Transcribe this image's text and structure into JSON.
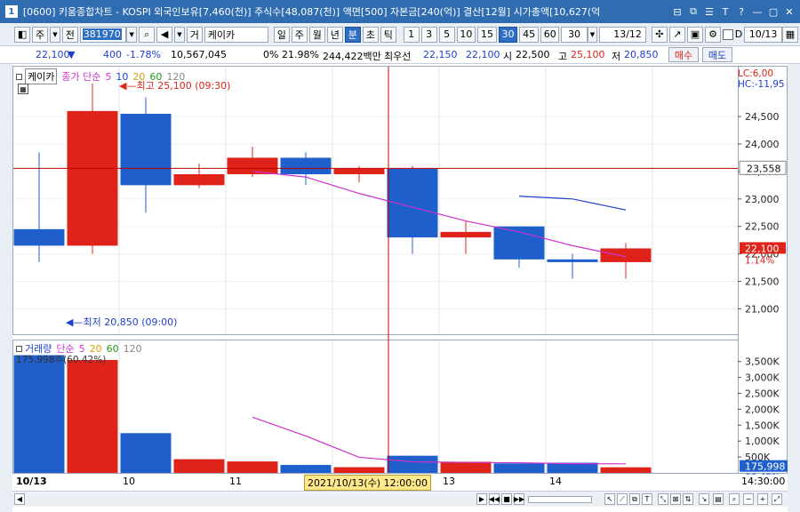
{
  "window": {
    "number": "1",
    "title": "[0600] 키움종합차트 - KOSPI 외국인보유[7,460(천)] 주식수[48,087(천)] 액면[500] 자본금[240(억)] 결산[12월] 시가총액[10,627(억",
    "buttons": [
      "⊟",
      "⧉",
      "☰",
      "T",
      "?",
      "—",
      "▢",
      "✕"
    ]
  },
  "toolbar": {
    "type_label": "주",
    "prev_label": "전",
    "code": "381970",
    "nav_icons": [
      "⌕",
      "◀",
      "▼"
    ],
    "search_type_label": "거",
    "stock_name": "케이카",
    "periods": [
      "일",
      "주",
      "월",
      "년",
      "분",
      "초",
      "틱"
    ],
    "active_period": "분",
    "minutes": [
      "1",
      "3",
      "5",
      "10",
      "15",
      "30",
      "45",
      "60"
    ],
    "active_minute": "30",
    "period_value": "30",
    "count": "13/12",
    "date_value": "10/13",
    "d_label": "D"
  },
  "quote": {
    "price": "22,100",
    "direction": "▼",
    "change": "400",
    "change_pct": "-1.78%",
    "volume": "10,567,045",
    "ratio": "0% 21.98%",
    "amount": "244,422백만",
    "best_bid_label": "최우선",
    "best_bid": "22,150",
    "best_ask": "22,100",
    "open_label": "시",
    "open": "22,500",
    "high_label": "고",
    "high": "25,100",
    "low_label": "저",
    "low": "20,850",
    "buy_label": "매수",
    "sell_label": "매도"
  },
  "price_panel": {
    "stock_label": "케이카",
    "legend_prefix": "종가 단순",
    "ma_periods": [
      "5",
      "10",
      "20",
      "60",
      "120"
    ],
    "ma_colors": [
      "#cc33cc",
      "#1f3fcc",
      "#d4a000",
      "#229922",
      "#888888"
    ],
    "high_annotation": "최고 25,100 (09:30)",
    "low_annotation": "최저 20,850 (09:00)",
    "lc_label": "LC:6,00",
    "hc_label": "HC:-11,95",
    "current_price": "23,558",
    "last_price": "22,100",
    "last_pct": "1.14%",
    "axis_ticks": [
      "24,500",
      "24,000",
      "23,500",
      "23,000",
      "22,500",
      "22,000",
      "21,500",
      "21,000"
    ]
  },
  "volume_panel": {
    "label": "거래량",
    "legend_prefix": "단순",
    "ma_periods": [
      "5",
      "20",
      "60",
      "120"
    ],
    "ma_colors": [
      "#cc33cc",
      "#d4a000",
      "#229922",
      "#888888"
    ],
    "annotation": "175,998주(60.42%)",
    "current_value": "175,998",
    "current_pct": "60.42%",
    "axis_ticks": [
      "3,500K",
      "3,000K",
      "2,500K",
      "2,000K",
      "1,500K",
      "1,000K",
      "500K"
    ]
  },
  "xaxis": {
    "labels": [
      "10/13",
      "10",
      "11",
      "13",
      "14"
    ],
    "crosshair_label": "2021/10/13(수) 12:00:00",
    "end_time": "14:30:00"
  },
  "colors": {
    "up": "#e0231a",
    "down": "#1f5fcc",
    "crosshair": "#c00000",
    "ma5": "#cc33cc",
    "ma10": "#1f3fcc"
  },
  "chart_data": {
    "type": "candlestick",
    "candles": [
      {
        "o": 22450,
        "h": 23850,
        "l": 21850,
        "c": 22150
      },
      {
        "o": 22150,
        "h": 25100,
        "l": 22000,
        "c": 24600
      },
      {
        "o": 24550,
        "h": 24850,
        "l": 22750,
        "c": 23250
      },
      {
        "o": 23250,
        "h": 23650,
        "l": 23200,
        "c": 23450
      },
      {
        "o": 23450,
        "h": 23950,
        "l": 23400,
        "c": 23750
      },
      {
        "o": 23750,
        "h": 23850,
        "l": 23250,
        "c": 23450
      },
      {
        "o": 23450,
        "h": 23600,
        "l": 23300,
        "c": 23550
      },
      {
        "o": 23550,
        "h": 23600,
        "l": 22000,
        "c": 22300
      },
      {
        "o": 22300,
        "h": 22600,
        "l": 22000,
        "c": 22400
      },
      {
        "o": 22500,
        "h": 22500,
        "l": 21750,
        "c": 21900
      },
      {
        "o": 21900,
        "h": 22000,
        "l": 21550,
        "c": 21850
      },
      {
        "o": 21850,
        "h": 22200,
        "l": 21550,
        "c": 22100
      }
    ],
    "ma5": [
      null,
      null,
      null,
      null,
      23500,
      23400,
      23100,
      22850,
      22600,
      22400,
      22150,
      21950
    ],
    "ma10": [
      null,
      null,
      null,
      null,
      null,
      null,
      null,
      null,
      null,
      23050,
      23000,
      22800
    ],
    "volume": [
      3700,
      3550,
      1250,
      430,
      360,
      250,
      180,
      540,
      350,
      300,
      320,
      176
    ],
    "volume_ma5": [
      null,
      null,
      null,
      null,
      1750,
      1160,
      490,
      350,
      330,
      320,
      290,
      285
    ],
    "ylim": [
      20700,
      25100
    ],
    "volume_ylim": [
      0,
      3800
    ],
    "crosshair_index": 6.55,
    "current_line": 23558
  }
}
